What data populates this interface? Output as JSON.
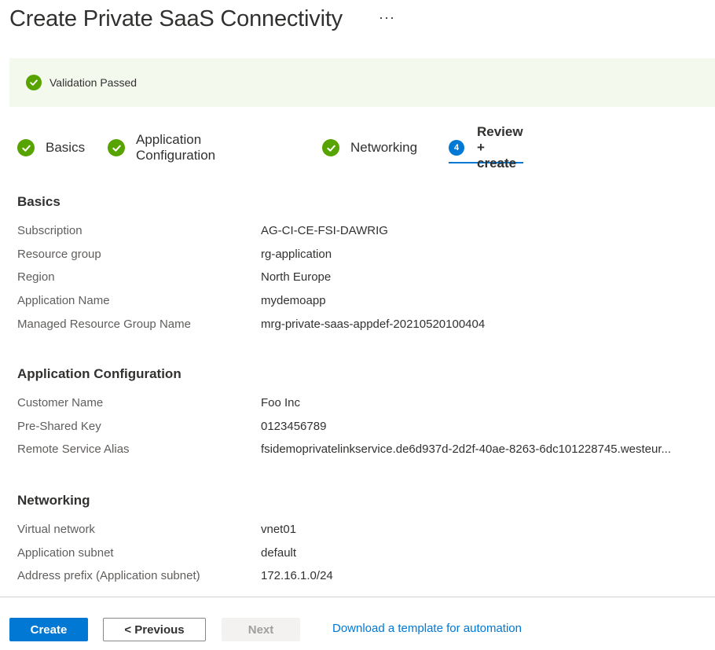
{
  "header": {
    "title": "Create Private SaaS Connectivity",
    "more_label": "···"
  },
  "validation": {
    "text": "Validation Passed",
    "status_color": "#57a300"
  },
  "tabs": [
    {
      "label": "Basics",
      "state": "complete",
      "icon": "check-circle-icon"
    },
    {
      "label": "Application Configuration",
      "state": "complete",
      "icon": "check-circle-icon"
    },
    {
      "label": "Networking",
      "state": "complete",
      "icon": "check-circle-icon"
    },
    {
      "label": "Review + create",
      "state": "active",
      "step": "4"
    }
  ],
  "sections": {
    "basics": {
      "heading": "Basics",
      "rows": [
        {
          "label": "Subscription",
          "value": "AG-CI-CE-FSI-DAWRIG"
        },
        {
          "label": "Resource group",
          "value": "rg-application"
        },
        {
          "label": "Region",
          "value": "North Europe"
        },
        {
          "label": "Application Name",
          "value": "mydemoapp"
        },
        {
          "label": "Managed Resource Group Name",
          "value": "mrg-private-saas-appdef-20210520100404"
        }
      ]
    },
    "app_config": {
      "heading": "Application Configuration",
      "rows": [
        {
          "label": "Customer Name",
          "value": "Foo Inc"
        },
        {
          "label": "Pre-Shared Key",
          "value": "0123456789"
        },
        {
          "label": "Remote Service Alias",
          "value": "fsidemoprivatelinkservice.de6d937d-2d2f-40ae-8263-6dc101228745.westeur..."
        }
      ]
    },
    "networking": {
      "heading": "Networking",
      "rows": [
        {
          "label": "Virtual network",
          "value": "vnet01"
        },
        {
          "label": "Application subnet",
          "value": "default"
        },
        {
          "label": "Address prefix (Application subnet)",
          "value": "172.16.1.0/24"
        }
      ]
    }
  },
  "footer": {
    "create_label": "Create",
    "previous_label": "< Previous",
    "next_label": "Next",
    "download_link": "Download a template for automation"
  },
  "colors": {
    "accent": "#0078d4",
    "success": "#57a300",
    "validation_bg": "#f4f9ee"
  }
}
